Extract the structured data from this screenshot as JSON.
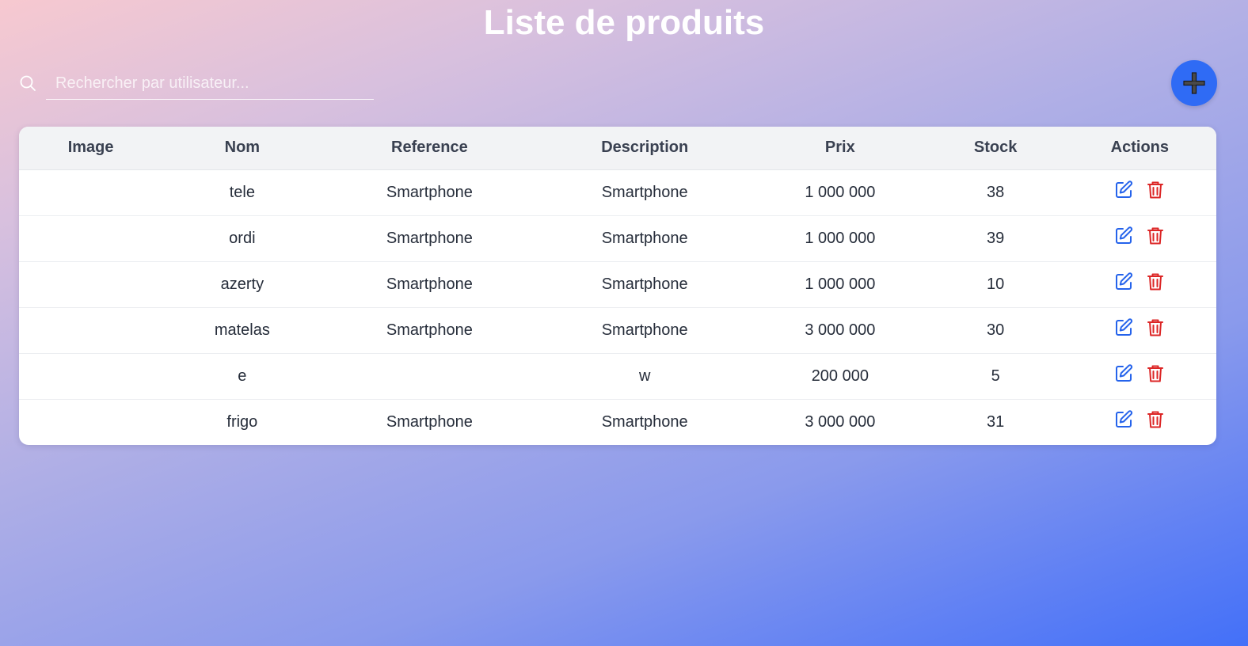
{
  "page": {
    "title": "Liste de produits"
  },
  "search": {
    "placeholder": "Rechercher par utilisateur...",
    "icon": "search-icon"
  },
  "add_button": {
    "icon": "plus-icon"
  },
  "table": {
    "headers": [
      "Image",
      "Nom",
      "Reference",
      "Description",
      "Prix",
      "Stock",
      "Actions"
    ],
    "rows": [
      {
        "image": "",
        "nom": "tele",
        "reference": "Smartphone",
        "description": "Smartphone",
        "prix": "1 000 000",
        "stock": "38"
      },
      {
        "image": "",
        "nom": "ordi",
        "reference": "Smartphone",
        "description": "Smartphone",
        "prix": "1 000 000",
        "stock": "39"
      },
      {
        "image": "",
        "nom": "azerty",
        "reference": "Smartphone",
        "description": "Smartphone",
        "prix": "1 000 000",
        "stock": "10"
      },
      {
        "image": "",
        "nom": "matelas",
        "reference": "Smartphone",
        "description": "Smartphone",
        "prix": "3 000 000",
        "stock": "30"
      },
      {
        "image": "",
        "nom": "e",
        "reference": "",
        "description": "w",
        "prix": "200 000",
        "stock": "5"
      },
      {
        "image": "",
        "nom": "frigo",
        "reference": "Smartphone",
        "description": "Smartphone",
        "prix": "3 000 000",
        "stock": "31"
      }
    ],
    "action_icons": [
      "edit-icon",
      "trash-icon"
    ]
  },
  "colors": {
    "accent": "#2f6bf5",
    "edit": "#2563eb",
    "delete": "#dc2626",
    "header_bg": "#f2f3f5"
  }
}
